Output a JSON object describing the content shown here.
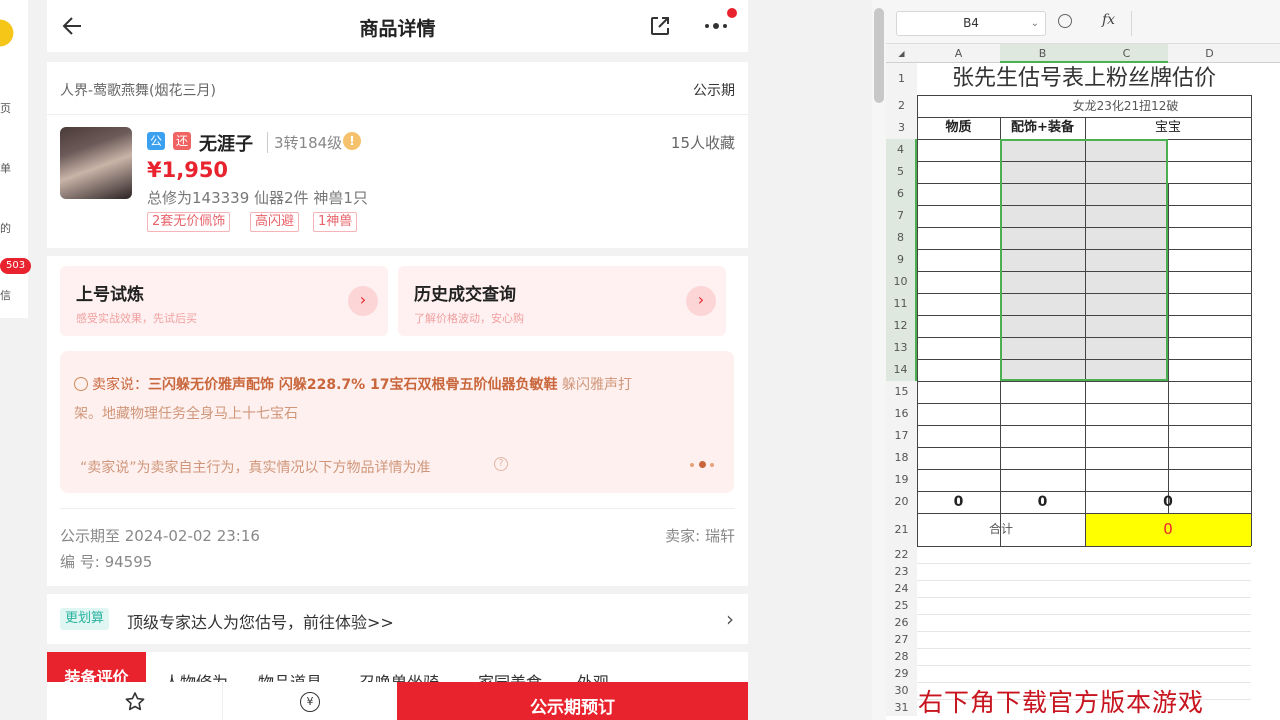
{
  "left_nav": {
    "items": [
      "页",
      "单",
      "的",
      "信"
    ],
    "badge": "503"
  },
  "phone": {
    "header": {
      "title": "商品详情"
    },
    "product": {
      "game": "人界-莺歌燕舞(烟花三月)",
      "status": "公示期",
      "tag_public": "公",
      "tag_return": "还",
      "name": "无涯子",
      "level": "3转184级",
      "favorites": "15人收藏",
      "price": "¥1,950",
      "stats": "总修为143339  仙器2件  神兽1只",
      "chips": [
        "2套无价佩饰",
        "高闪避",
        "1神兽"
      ]
    },
    "tiles": [
      {
        "title": "上号试炼",
        "sub": "感受实战效果，先试后买"
      },
      {
        "title": "历史成交查询",
        "sub": "了解价格波动，安心购"
      }
    ],
    "seller_says": {
      "prefix": "卖家说：",
      "bold": "三闪躲无价雅声配饰 闪躲228.7% 17宝石双根骨五阶仙器负敏鞋",
      "rest_line1": " 躲闪雅声打",
      "line2": "架。地藏物理任务全身马上十七宝石",
      "disclaimer": "“卖家说”为卖家自主行为，真实情况以下方物品详情为准"
    },
    "info": {
      "public_until": "公示期至 2024-02-02 23:16",
      "seller": "卖家: 瑞轩",
      "serial": "编 号: 94595"
    },
    "estimate": {
      "badge": "更划算",
      "text": "顶级专家达人为您估号，前往体验>>"
    },
    "tabs": [
      "装备评价",
      "人物修为",
      "物品道具",
      "召唤兽坐骑",
      "家园美食",
      "外观"
    ],
    "bottom": {
      "reserve": "公示期预订"
    }
  },
  "spreadsheet": {
    "name_box": "B4",
    "fx": "fx",
    "columns": [
      "A",
      "B",
      "C",
      "D"
    ],
    "rows": [
      "1",
      "2",
      "3",
      "4",
      "5",
      "6",
      "7",
      "8",
      "9",
      "10",
      "11",
      "12",
      "13",
      "14",
      "15",
      "16",
      "17",
      "18",
      "19",
      "20",
      "21",
      "22",
      "23",
      "24",
      "25",
      "26",
      "27",
      "28",
      "29",
      "30",
      "31"
    ],
    "title": "张先生估号表上粉丝牌估价",
    "subtitle": "女龙23化21扭12破",
    "headers": [
      "物质",
      "配饰+装备",
      "宝宝"
    ],
    "row20": [
      "0",
      "0",
      "0"
    ],
    "total_label": "合计",
    "total_value": "0",
    "highlight_color": "#ffff00",
    "selection_color": "#4caf50"
  },
  "overlay_text": "右下角下载官方版本游戏"
}
